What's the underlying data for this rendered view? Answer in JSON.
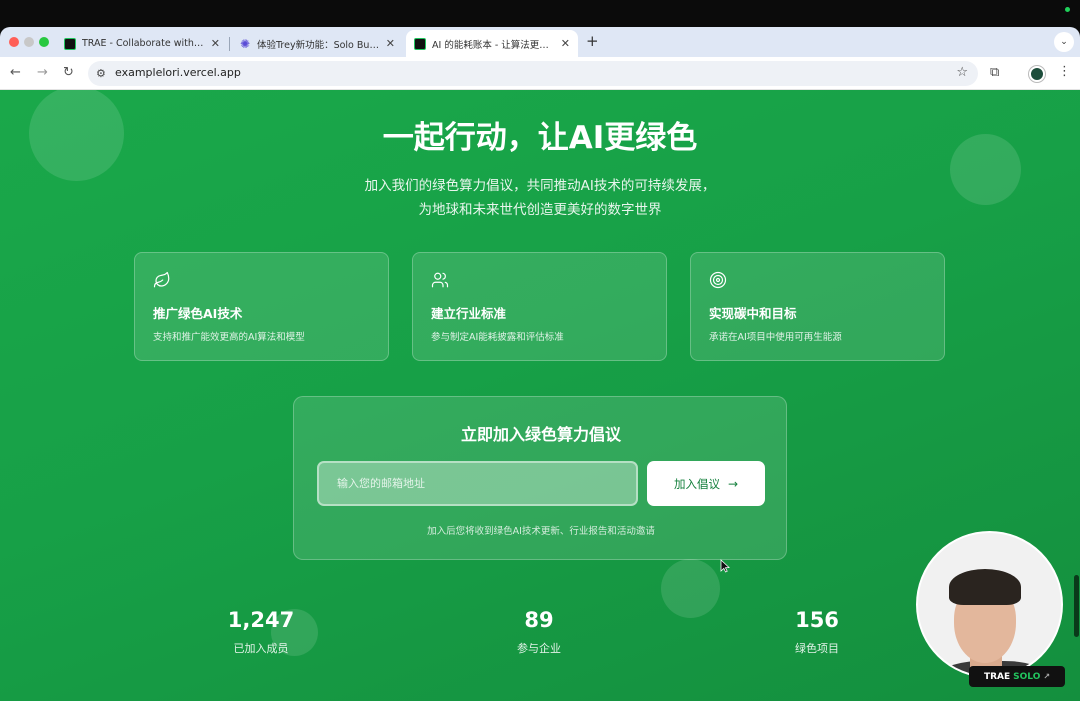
{
  "browser": {
    "tabs": [
      {
        "title": "TRAE - Collaborate with Intelligence"
      },
      {
        "title": "体验Trey新功能：Solo Builder"
      },
      {
        "title": "AI 的能耗账本 - 让算法更高效"
      }
    ],
    "tab_close": "✕",
    "new_tab": "+",
    "tab_menu": "⌄",
    "url": "examplelori.vercel.app"
  },
  "page": {
    "title": "一起行动，让AI更绿色",
    "subtitle_line1": "加入我们的绿色算力倡议，共同推动AI技术的可持续发展，",
    "subtitle_line2": "为地球和未来世代创造更美好的数字世界",
    "cards": [
      {
        "icon": "leaf-icon",
        "title": "推广绿色AI技术",
        "desc": "支持和推广能效更高的AI算法和模型"
      },
      {
        "icon": "users-icon",
        "title": "建立行业标准",
        "desc": "参与制定AI能耗披露和评估标准"
      },
      {
        "icon": "target-icon",
        "title": "实现碳中和目标",
        "desc": "承诺在AI项目中使用可再生能源"
      }
    ],
    "join": {
      "title": "立即加入绿色算力倡议",
      "email_placeholder": "输入您的邮箱地址",
      "button_label": "加入倡议",
      "note": "加入后您将收到绿色AI技术更新、行业报告和活动邀请"
    },
    "stats": [
      {
        "value": "1,247",
        "label": "已加入成员"
      },
      {
        "value": "89",
        "label": "参与企业"
      },
      {
        "value": "156",
        "label": "绿色项目"
      }
    ]
  },
  "overlay": {
    "badge_trae": "TRAE",
    "badge_solo": "SOLO"
  },
  "colors": {
    "accent_green": "#17a047",
    "button_text": "#15803d"
  }
}
